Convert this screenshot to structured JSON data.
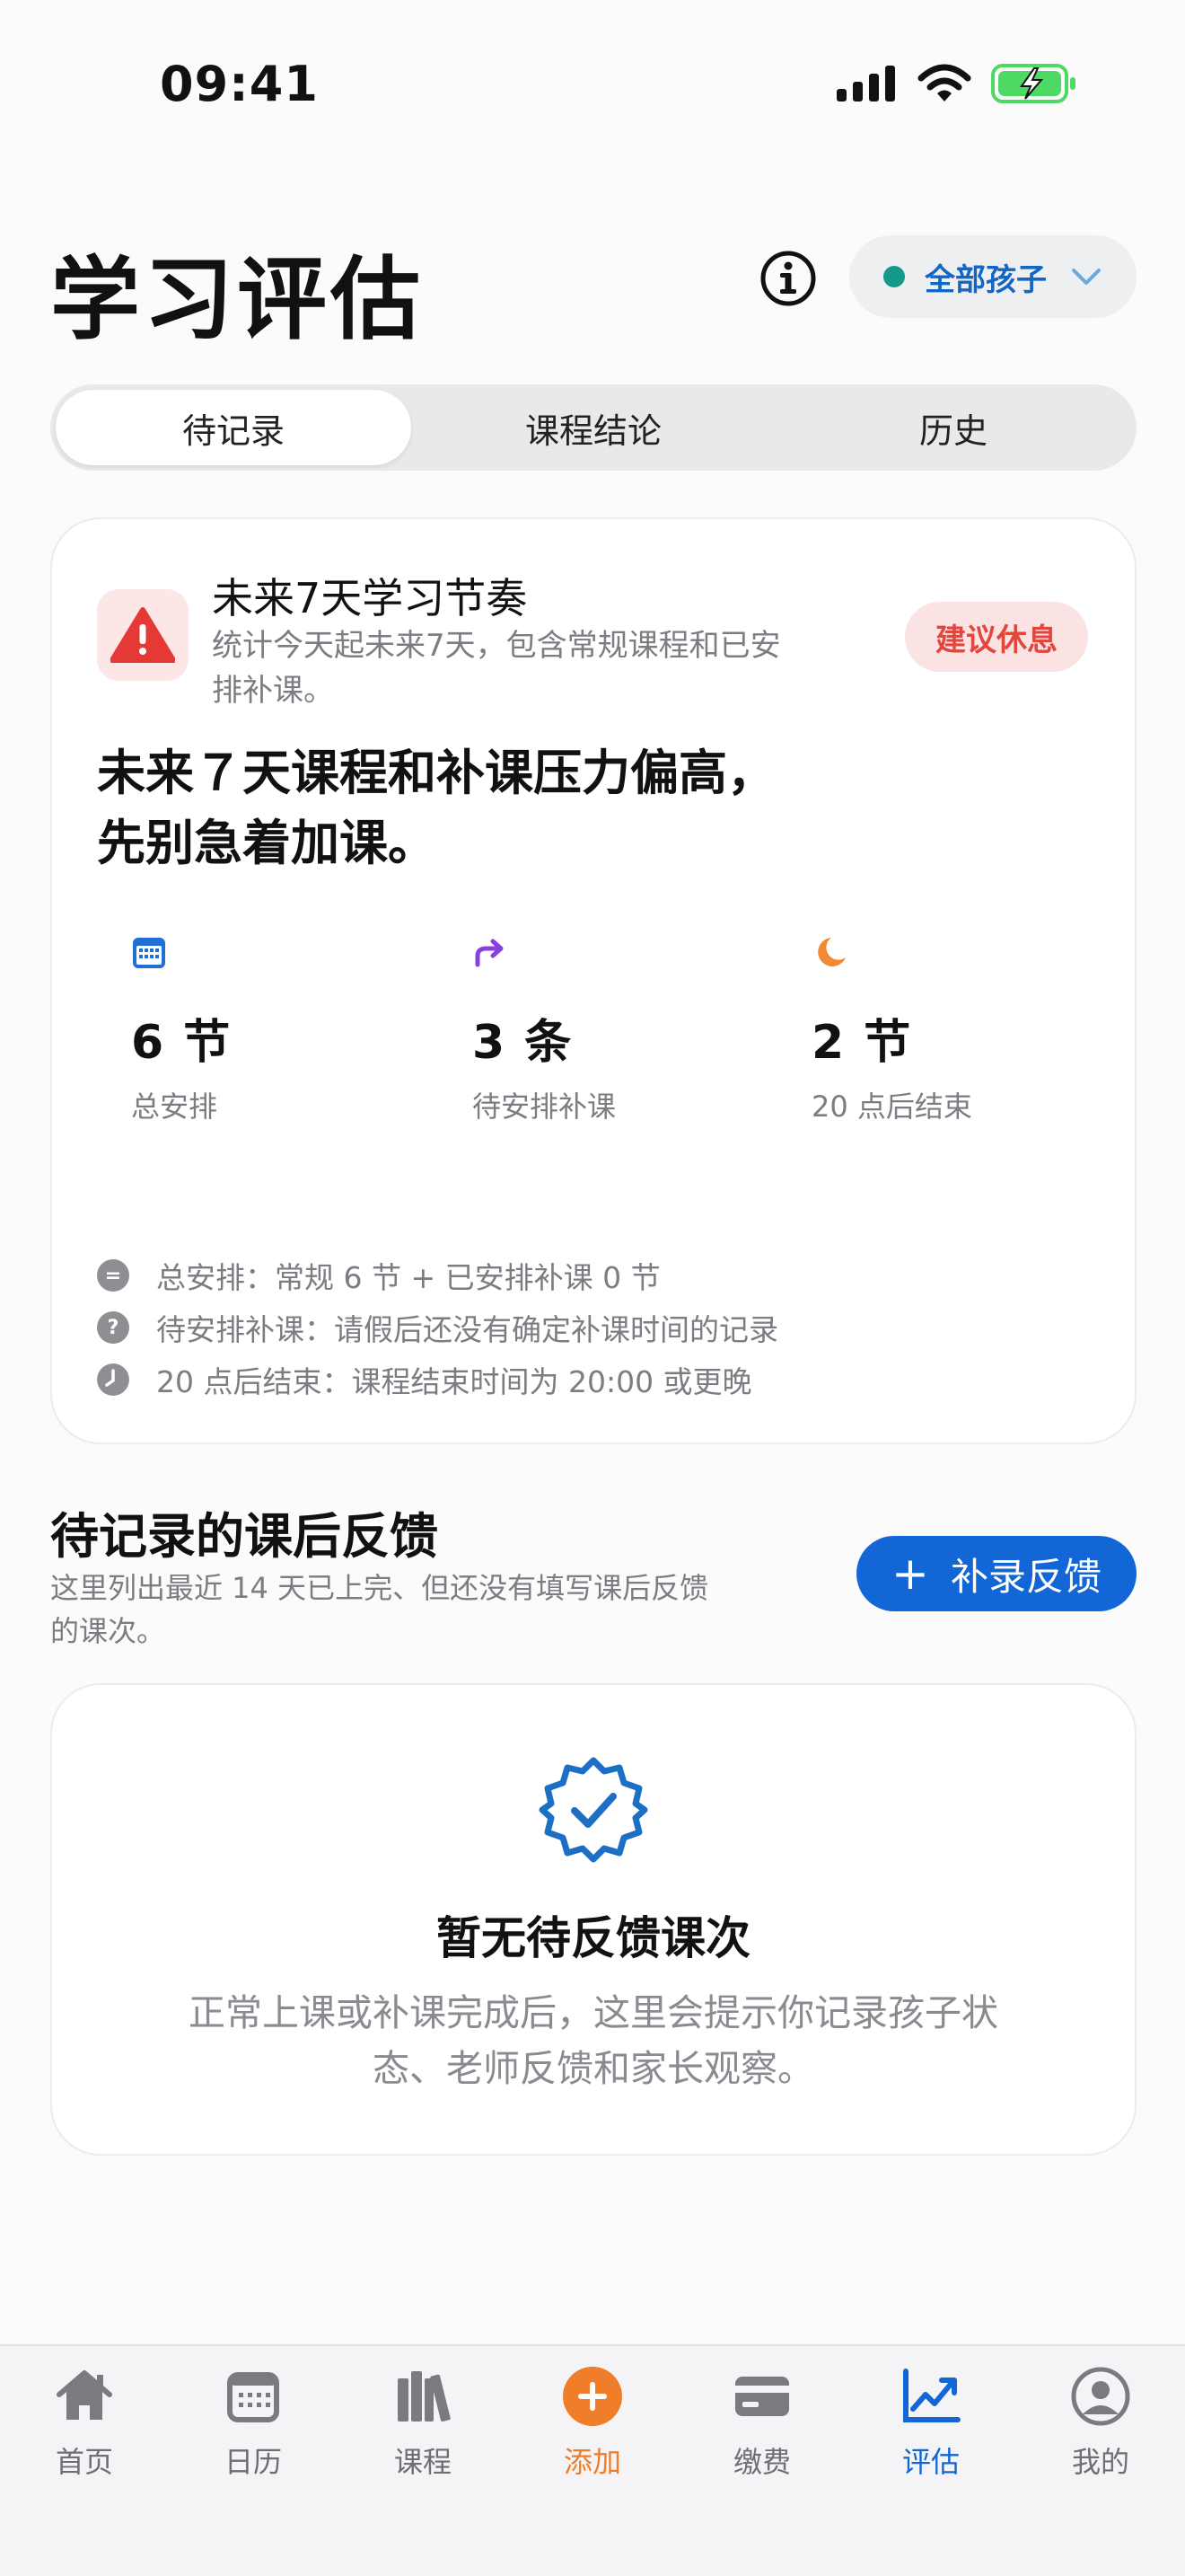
{
  "status_bar": {
    "time": "09:41"
  },
  "header": {
    "title": "学习评估",
    "child_filter": "全部孩子"
  },
  "tabs": [
    {
      "label": "待记录",
      "active": true
    },
    {
      "label": "课程结论",
      "active": false
    },
    {
      "label": "历史",
      "active": false
    }
  ],
  "rhythm_card": {
    "title": "未来7天学习节奏",
    "subtitle": "统计今天起未来7天，包含常规课程和已安排补课。",
    "badge": "建议休息",
    "headline": "未来７天课程和补课压力偏高，先别急着加课。",
    "stats": [
      {
        "icon": "calendar-icon",
        "value": "6 节",
        "label": "总安排",
        "color": "#1f6fd6"
      },
      {
        "icon": "redo-arrow-icon",
        "value": "3 条",
        "label": "待安排补课",
        "color": "#8a3fe0"
      },
      {
        "icon": "moon-icon",
        "value": "2 节",
        "label": "20 点后结束",
        "color": "#f08a34"
      }
    ],
    "notes": [
      {
        "icon": "equals-icon",
        "text": "总安排：常规 6 节 + 已安排补课 0 节"
      },
      {
        "icon": "question-icon",
        "text": "待安排补课：请假后还没有确定补课时间的记录"
      },
      {
        "icon": "clock-icon",
        "text": "20 点后结束：课程结束时间为 20:00 或更晚"
      }
    ]
  },
  "pending": {
    "title": "待记录的课后反馈",
    "subtitle": "这里列出最近 14 天已上完、但还没有填写课后反馈的课次。",
    "add_button": "补录反馈",
    "empty_title": "暂无待反馈课次",
    "empty_text": "正常上课或补课完成后，这里会提示你记录孩子状态、老师反馈和家长观察。"
  },
  "tabbar": [
    {
      "label": "首页",
      "icon": "home-icon"
    },
    {
      "label": "日历",
      "icon": "calendar-icon"
    },
    {
      "label": "课程",
      "icon": "books-icon"
    },
    {
      "label": "添加",
      "icon": "add-circle-icon",
      "accent": "#f07d2a"
    },
    {
      "label": "缴费",
      "icon": "card-icon"
    },
    {
      "label": "评估",
      "icon": "chart-icon",
      "accent": "#1266d6"
    },
    {
      "label": "我的",
      "icon": "person-icon"
    }
  ]
}
